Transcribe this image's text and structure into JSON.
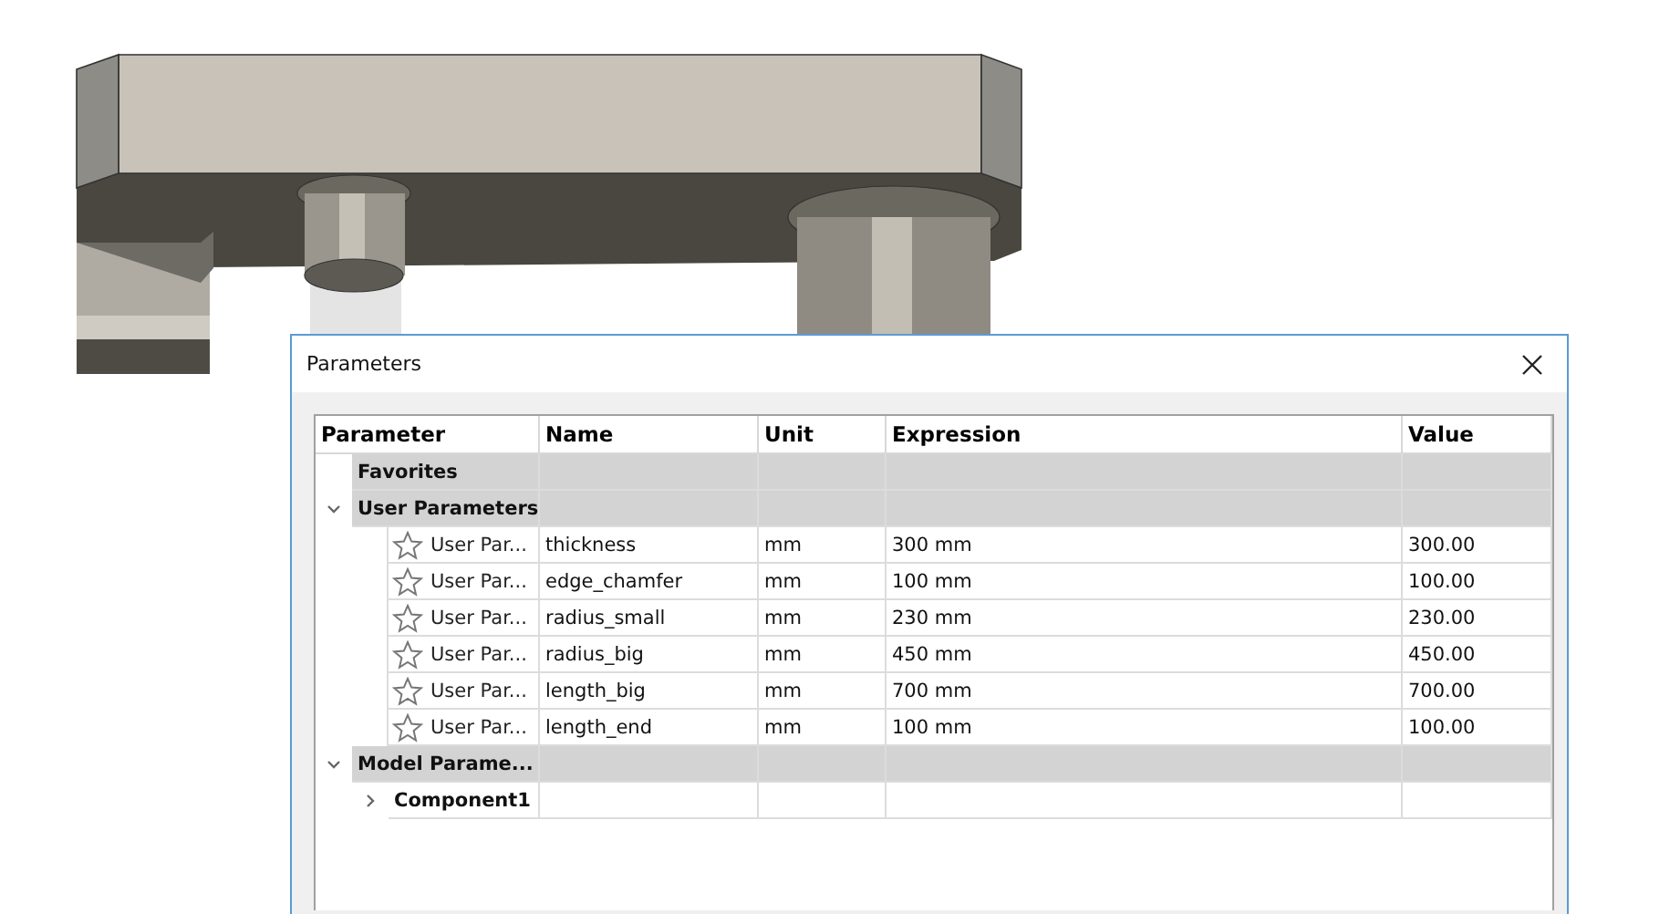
{
  "dialog": {
    "title": "Parameters"
  },
  "table": {
    "columns": [
      "Parameter",
      "Name",
      "Unit",
      "Expression",
      "Value"
    ],
    "groups": [
      {
        "label": "Favorites"
      },
      {
        "label": "User Parameters",
        "expanded": true,
        "children": [
          {
            "parameter": "User Par...",
            "favorite": false,
            "name": "thickness",
            "unit": "mm",
            "expression": "300 mm",
            "value": "300.00"
          },
          {
            "parameter": "User Par...",
            "favorite": false,
            "name": "edge_chamfer",
            "unit": "mm",
            "expression": "100 mm",
            "value": "100.00"
          },
          {
            "parameter": "User Par...",
            "favorite": false,
            "name": "radius_small",
            "unit": "mm",
            "expression": "230 mm",
            "value": "230.00"
          },
          {
            "parameter": "User Par...",
            "favorite": false,
            "name": "radius_big",
            "unit": "mm",
            "expression": "450 mm",
            "value": "450.00"
          },
          {
            "parameter": "User Par...",
            "favorite": false,
            "name": "length_big",
            "unit": "mm",
            "expression": "700 mm",
            "value": "700.00"
          },
          {
            "parameter": "User Par...",
            "favorite": false,
            "name": "length_end",
            "unit": "mm",
            "expression": "100 mm",
            "value": "100.00"
          }
        ]
      },
      {
        "label": "Model Parame...",
        "expanded": true,
        "components": [
          {
            "label": "Component1",
            "expanded": false
          }
        ]
      }
    ]
  }
}
